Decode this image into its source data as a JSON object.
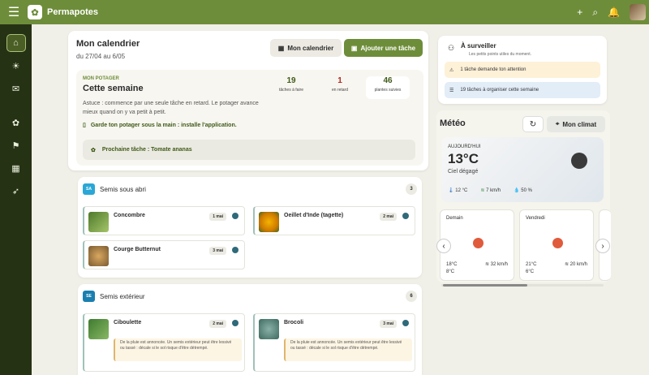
{
  "app": {
    "brand": "Permapotes"
  },
  "topbar": {
    "menu_icon": "menu-icon",
    "add_icon": "plus-icon",
    "search_icon": "search-icon",
    "bell_icon": "bell-icon"
  },
  "sidebar": {
    "items": [
      "home-icon",
      "lightbulb-icon",
      "chat-icon",
      "sprout-icon",
      "flag-icon",
      "calendar-icon",
      "rocket-icon"
    ]
  },
  "calendar": {
    "title": "Mon calendrier",
    "range": "du 27/04 au 6/05",
    "btn_calendar": "Mon calendrier",
    "btn_add": "Ajouter une tâche"
  },
  "week": {
    "overline": "MON POTAGER",
    "title": "Cette semaine",
    "tip": "Astuce : commence par une seule tâche en retard. Le potager avance mieux quand on y va petit à petit.",
    "install": "Garde ton potager sous la main : installe l'application.",
    "stats": [
      {
        "value": "19",
        "label": "tâches à faire"
      },
      {
        "value": "1",
        "label": "en retard"
      },
      {
        "value": "46",
        "label": "plantes suivies"
      }
    ],
    "next_task": "Prochaine tâche : Tomate ananas"
  },
  "sections": [
    {
      "badge": "SA",
      "title": "Semis sous abri",
      "count": "3",
      "tasks": [
        {
          "name": "Concombre",
          "date": "1 mai"
        },
        {
          "name": "Oeillet d'Inde (tagette)",
          "date": "2 mai"
        },
        {
          "name": "Courge Butternut",
          "date": "3 mai"
        }
      ]
    },
    {
      "badge": "SE",
      "title": "Semis extérieur",
      "count": "6",
      "tasks": [
        {
          "name": "Ciboulette",
          "date": "2 mai",
          "note": "De la pluie est annoncée. Un semis extérieur peut être lessivé ou tassé : décale si le sol risque d'être détrempé."
        },
        {
          "name": "Brocoli",
          "date": "3 mai",
          "note": "De la pluie est annoncée. Un semis extérieur peut être lessivé ou tassé : décale si le sol risque d'être détrempé."
        }
      ]
    }
  ],
  "watch": {
    "title": "À surveiller",
    "subtitle": "Les petits points utiles du moment.",
    "alert_warning": "1 tâche demande ton attention",
    "alert_info": "19 tâches à organiser cette semaine"
  },
  "meteo": {
    "title": "Météo",
    "btn_climat": "Mon climat",
    "today": {
      "label": "AUJOURD'HUI",
      "temp": "13°C",
      "desc": "Ciel dégagé",
      "t_min": "12 °C",
      "wind": "7 km/h",
      "rain": "50 %"
    },
    "forecast": [
      {
        "day": "Demain",
        "t_max": "18°C",
        "t_min": "8°C",
        "wind": "32 km/h"
      },
      {
        "day": "Vendredi",
        "t_max": "21°C",
        "t_min": "6°C",
        "wind": "20 km/h"
      }
    ]
  },
  "colors": {
    "primary": "#6e8d3a",
    "sidebar": "#263214",
    "late": "#b3261e",
    "sun": "#e05a3c"
  }
}
